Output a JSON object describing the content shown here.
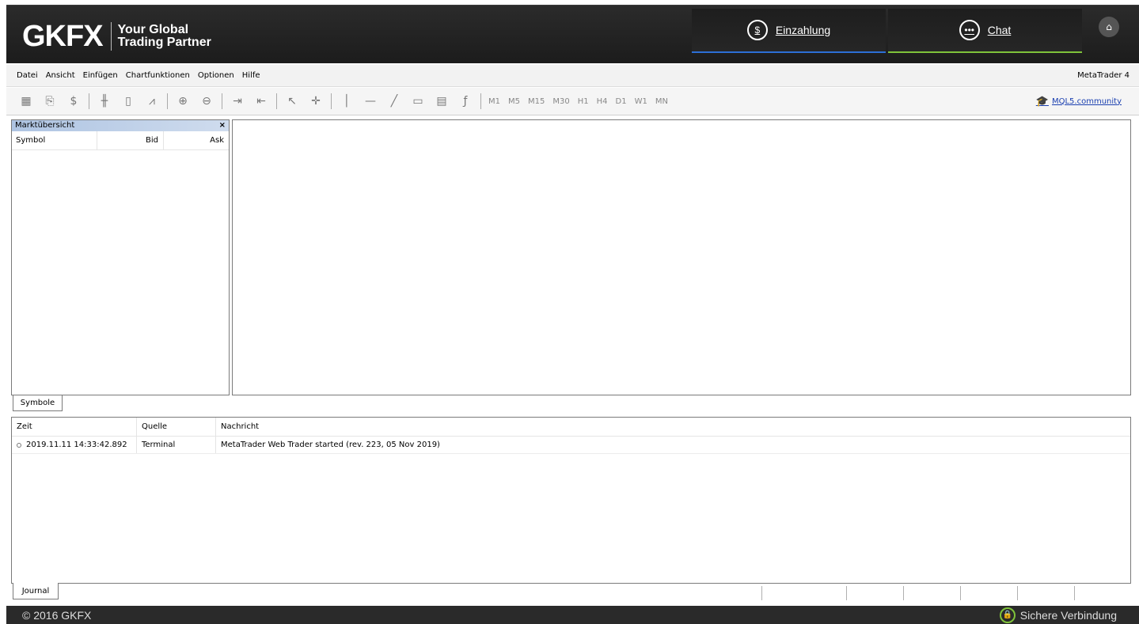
{
  "header": {
    "logo_text": "GKFX",
    "tagline_line1": "Your Global",
    "tagline_line2": "Trading Partner",
    "deposit_label": "Einzahlung",
    "chat_label": "Chat"
  },
  "menu": {
    "items": [
      "Datei",
      "Ansicht",
      "Einfügen",
      "Chartfunktionen",
      "Optionen",
      "Hilfe"
    ],
    "app_name": "MetaTrader 4"
  },
  "toolbar": {
    "timeframes": [
      "M1",
      "M5",
      "M15",
      "M30",
      "H1",
      "H4",
      "D1",
      "W1",
      "MN"
    ],
    "community_link": "MQL5.community"
  },
  "market_watch": {
    "title": "Marktübersicht",
    "close_label": "×",
    "columns": {
      "symbol": "Symbol",
      "bid": "Bid",
      "ask": "Ask"
    },
    "tab_label": "Symbole"
  },
  "journal": {
    "columns": {
      "time": "Zeit",
      "source": "Quelle",
      "message": "Nachricht"
    },
    "rows": [
      {
        "time": "2019.11.11 14:33:42.892",
        "source": "Terminal",
        "message": "MetaTrader Web Trader started (rev. 223, 05 Nov 2019)"
      }
    ],
    "tab_label": "Journal"
  },
  "footer": {
    "copyright": "© 2016 GKFX",
    "secure_label": "Sichere Verbindung"
  },
  "colors": {
    "deposit_accent": "#2c6fd6",
    "chat_accent": "#7fc23a",
    "secure_accent": "#7fc23a"
  }
}
